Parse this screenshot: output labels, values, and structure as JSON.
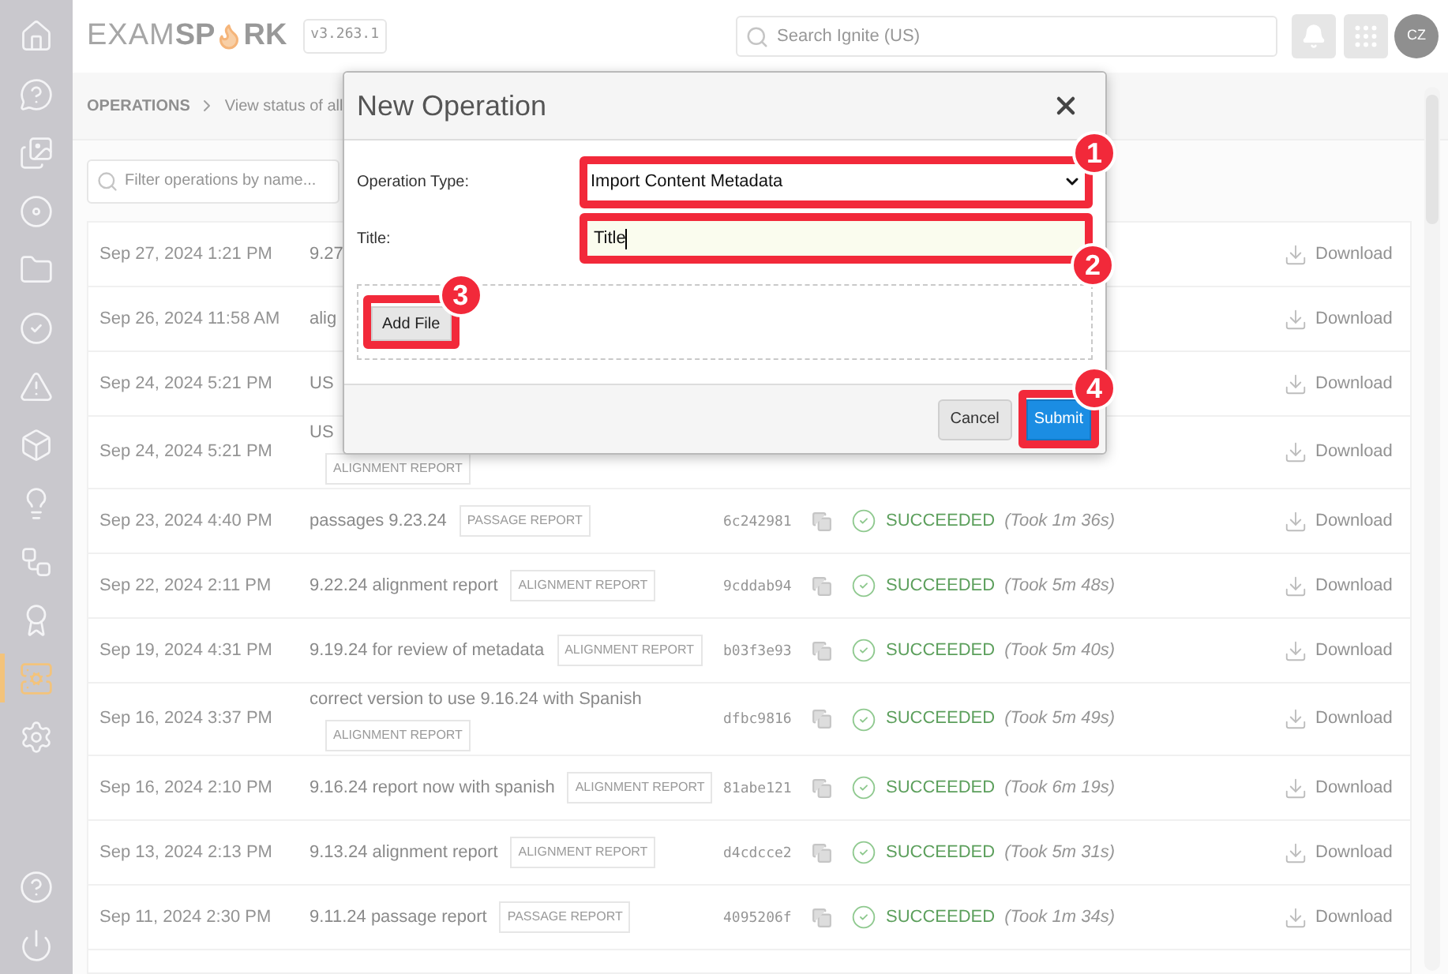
{
  "logo": {
    "left": "EXAM",
    "middle": "SP",
    "right": "RK"
  },
  "version": "v3.263.1",
  "search": {
    "placeholder": "Search Ignite (US)"
  },
  "avatar": "CZ",
  "sidebar": {
    "items": [
      {
        "selected": false
      },
      {
        "selected": false
      },
      {
        "selected": false
      },
      {
        "selected": false
      },
      {
        "selected": false
      },
      {
        "selected": false
      },
      {
        "selected": false
      },
      {
        "selected": false
      },
      {
        "selected": false
      },
      {
        "selected": false
      },
      {
        "selected": false
      },
      {
        "selected": true
      },
      {
        "selected": false
      }
    ],
    "bottom": [
      {
        "selected": false
      },
      {
        "selected": false
      }
    ]
  },
  "breadcrumb": {
    "section": "OPERATIONS",
    "description": "View status of all"
  },
  "filter": {
    "placeholder": "Filter operations by name..."
  },
  "rows": [
    {
      "date": "Sep 27, 2024 1:21 PM",
      "name": "9.27",
      "action": "Download"
    },
    {
      "date": "Sep 26, 2024 11:58 AM",
      "name": "alig",
      "action": "Download"
    },
    {
      "date": "Sep 24, 2024 5:21 PM",
      "name": "US",
      "action": "Download"
    },
    {
      "date": "Sep 24, 2024 5:21 PM",
      "name": "US",
      "tag": "ALIGNMENT REPORT",
      "wrap": true,
      "action": "Download"
    },
    {
      "date": "Sep 23, 2024 4:40 PM",
      "name": "passages 9.23.24",
      "tag": "PASSAGE REPORT",
      "hash": "6c242981",
      "status": "SUCCEEDED",
      "duration": "(Took 1m 36s)",
      "action": "Download"
    },
    {
      "date": "Sep 22, 2024 2:11 PM",
      "name": "9.22.24 alignment report",
      "tag": "ALIGNMENT REPORT",
      "hash": "9cddab94",
      "status": "SUCCEEDED",
      "duration": "(Took 5m 48s)",
      "action": "Download"
    },
    {
      "date": "Sep 19, 2024 4:31 PM",
      "name": "9.19.24 for review of metadata",
      "tag": "ALIGNMENT REPORT",
      "hash": "b03f3e93",
      "status": "SUCCEEDED",
      "duration": "(Took 5m 40s)",
      "action": "Download"
    },
    {
      "date": "Sep 16, 2024 3:37 PM",
      "name": "correct version to use 9.16.24 with Spanish",
      "tag": "ALIGNMENT REPORT",
      "wrap": true,
      "hash": "dfbc9816",
      "status": "SUCCEEDED",
      "duration": "(Took 5m 49s)",
      "action": "Download"
    },
    {
      "date": "Sep 16, 2024 2:10 PM",
      "name": "9.16.24 report now with spanish",
      "tag": "ALIGNMENT REPORT",
      "hash": "81abe121",
      "status": "SUCCEEDED",
      "duration": "(Took 6m 19s)",
      "action": "Download"
    },
    {
      "date": "Sep 13, 2024 2:13 PM",
      "name": "9.13.24 alignment report",
      "tag": "ALIGNMENT REPORT",
      "hash": "d4cdcce2",
      "status": "SUCCEEDED",
      "duration": "(Took 5m 31s)",
      "action": "Download"
    },
    {
      "date": "Sep 11, 2024 2:30 PM",
      "name": "9.11.24 passage report",
      "tag": "PASSAGE REPORT",
      "hash": "4095206f",
      "status": "SUCCEEDED",
      "duration": "(Took 1m 34s)",
      "action": "Download"
    }
  ],
  "dialog": {
    "title": "New Operation",
    "fields": [
      {
        "label": "Operation Type:",
        "kind": "select",
        "value": "Import Content Metadata",
        "step": "1"
      },
      {
        "label": "Title:",
        "kind": "text",
        "value": "Title",
        "step": "2"
      }
    ],
    "add_file": {
      "label": "Add File",
      "step": "3"
    },
    "buttons": [
      {
        "label": "Cancel",
        "kind": "secondary"
      },
      {
        "label": "Submit",
        "kind": "primary",
        "step": "4"
      }
    ]
  }
}
